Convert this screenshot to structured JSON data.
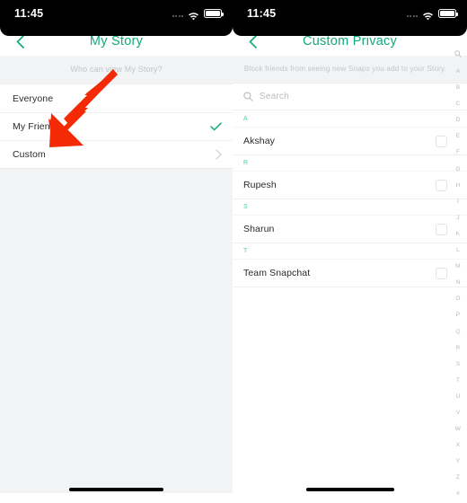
{
  "accent_green": "#13A97C",
  "section_green": "#4ECBA0",
  "annotation_color": "#F42A06",
  "status_bar": {
    "time": "11:45",
    "signal_icon": "signal-dots-icon",
    "wifi_icon": "wifi-icon",
    "battery_icon": "battery-full-icon"
  },
  "left_panel": {
    "back_icon": "chevron-left-icon",
    "title": "My Story",
    "subtitle": "Who can view My Story?",
    "options": [
      {
        "label": "Everyone",
        "accessory": "none"
      },
      {
        "label": "My Friends",
        "accessory": "checkmark-icon"
      },
      {
        "label": "Custom",
        "accessory": "chevron-right-icon"
      }
    ]
  },
  "right_panel": {
    "back_icon": "chevron-left-icon",
    "title": "Custom Privacy",
    "subtitle": "Block friends from seeing new Snaps you add to your Story.",
    "search": {
      "icon": "search-icon",
      "placeholder": "Search",
      "value": ""
    },
    "sections": [
      {
        "letter": "A",
        "friends": [
          {
            "name": "Akshay",
            "checked": false
          }
        ]
      },
      {
        "letter": "R",
        "friends": [
          {
            "name": "Rupesh",
            "checked": false
          }
        ]
      },
      {
        "letter": "S",
        "friends": [
          {
            "name": "Sharun",
            "checked": false
          }
        ]
      },
      {
        "letter": "T",
        "friends": [
          {
            "name": "Team Snapchat",
            "checked": false
          }
        ]
      }
    ],
    "index_letters": [
      "A",
      "B",
      "C",
      "D",
      "E",
      "F",
      "G",
      "H",
      "I",
      "J",
      "K",
      "L",
      "M",
      "N",
      "O",
      "P",
      "Q",
      "R",
      "S",
      "T",
      "U",
      "V",
      "W",
      "X",
      "Y",
      "Z",
      "#"
    ],
    "index_top_icon": "search-icon"
  },
  "annotation": {
    "type": "arrow",
    "points_to": "Custom",
    "direction": "down-left",
    "icon": "red-arrow-icon"
  },
  "home_indicator": "home-indicator-bar"
}
